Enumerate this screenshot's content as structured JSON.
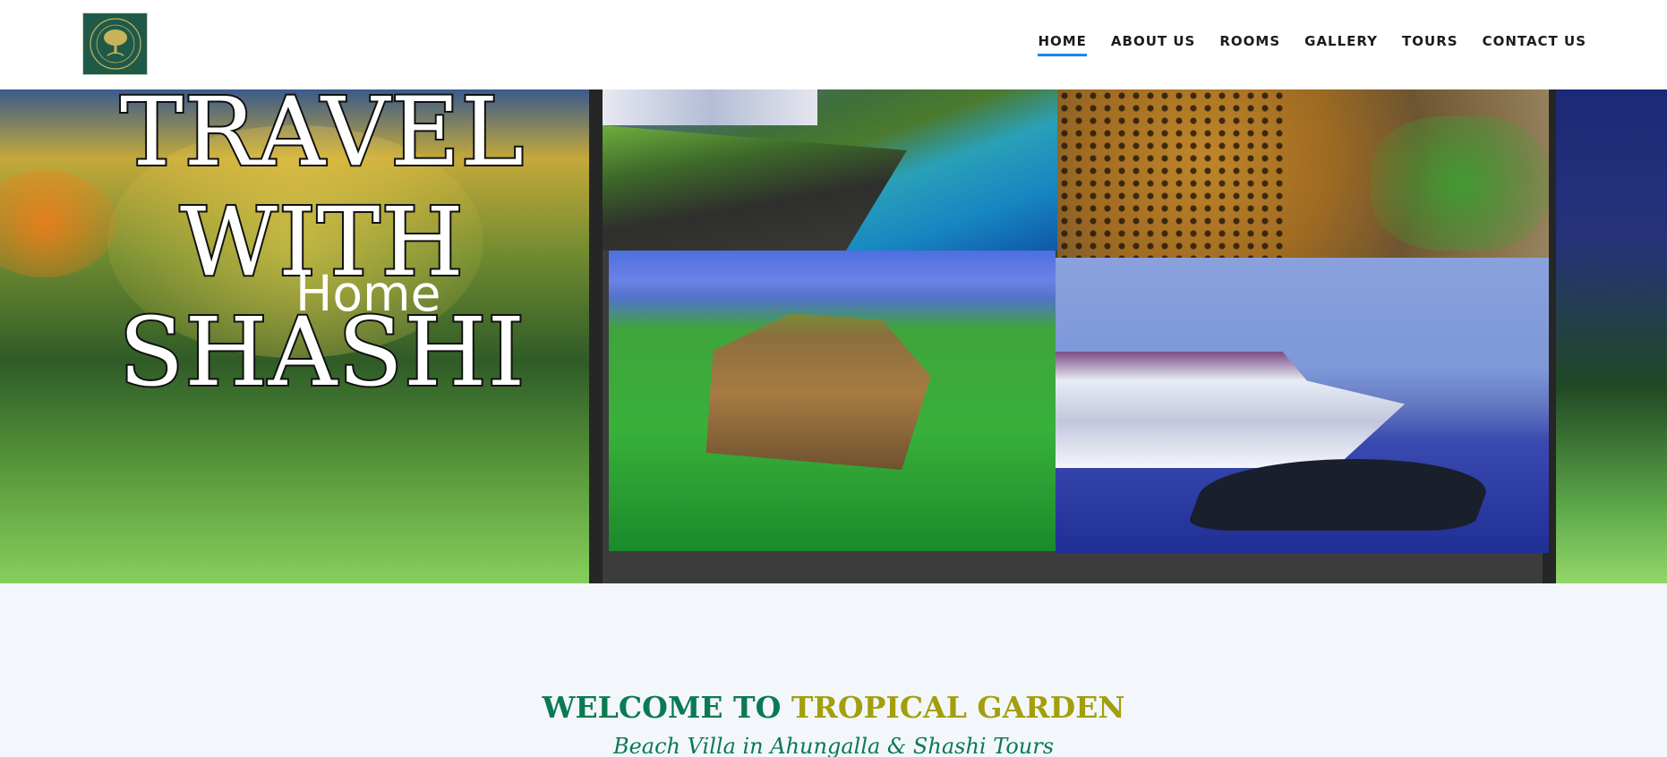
{
  "header": {
    "logo_text": "Tropical Garden Beach Villa"
  },
  "nav": {
    "items": [
      {
        "label": "HOME",
        "active": true
      },
      {
        "label": "ABOUT US",
        "active": false
      },
      {
        "label": "ROOMS",
        "active": false
      },
      {
        "label": "GALLERY",
        "active": false
      },
      {
        "label": "TOURS",
        "active": false
      },
      {
        "label": "CONTACT US",
        "active": false
      }
    ],
    "accent_color": "#1e88e5"
  },
  "hero": {
    "title_lines": [
      "TRAVEL",
      "WITH",
      "SHASHI"
    ],
    "subtitle": "Home",
    "images": [
      "coastline-image",
      "leopard-image",
      "sigiriya-rock-image",
      "whale-watching-boat-image"
    ]
  },
  "welcome": {
    "title_part1": "WELCOME TO",
    "title_part2": "TROPICAL GARDEN",
    "subtitle": "Beach Villa in Ahungalla & Shashi Tours",
    "colors": {
      "green": "#0a7a52",
      "olive": "#a39f0c"
    }
  }
}
